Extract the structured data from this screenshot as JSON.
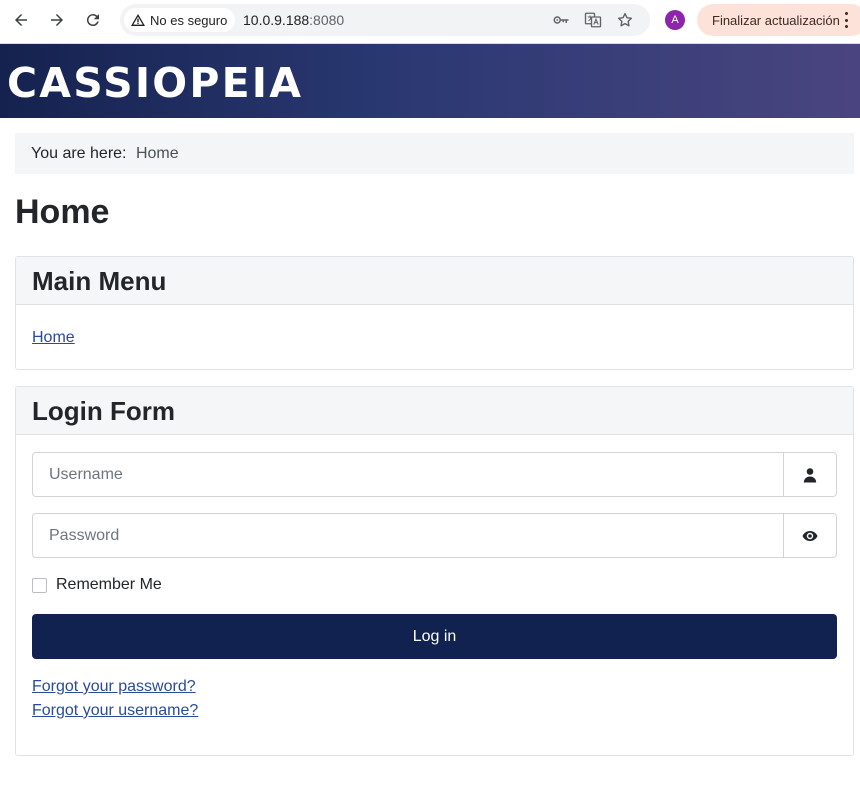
{
  "browser": {
    "security_label": "No es seguro",
    "url_host": "10.0.9.188",
    "url_port": ":8080",
    "profile_initial": "A",
    "update_label": "Finalizar actualización"
  },
  "site": {
    "brand": "CASSIOPEIA"
  },
  "breadcrumb": {
    "label": "You are here:",
    "items": [
      "Home"
    ]
  },
  "page": {
    "title": "Home"
  },
  "main_menu": {
    "title": "Main Menu",
    "items": [
      "Home"
    ]
  },
  "login_form": {
    "title": "Login Form",
    "username_placeholder": "Username",
    "password_placeholder": "Password",
    "remember_label": "Remember Me",
    "remember_checked": false,
    "submit_label": "Log in",
    "forgot_password": "Forgot your password?",
    "forgot_username": "Forgot your username?"
  },
  "colors": {
    "header_gradient_start": "#15224f",
    "header_gradient_end": "#4a4580",
    "primary_button": "#112150",
    "link": "#2a4a9c"
  }
}
